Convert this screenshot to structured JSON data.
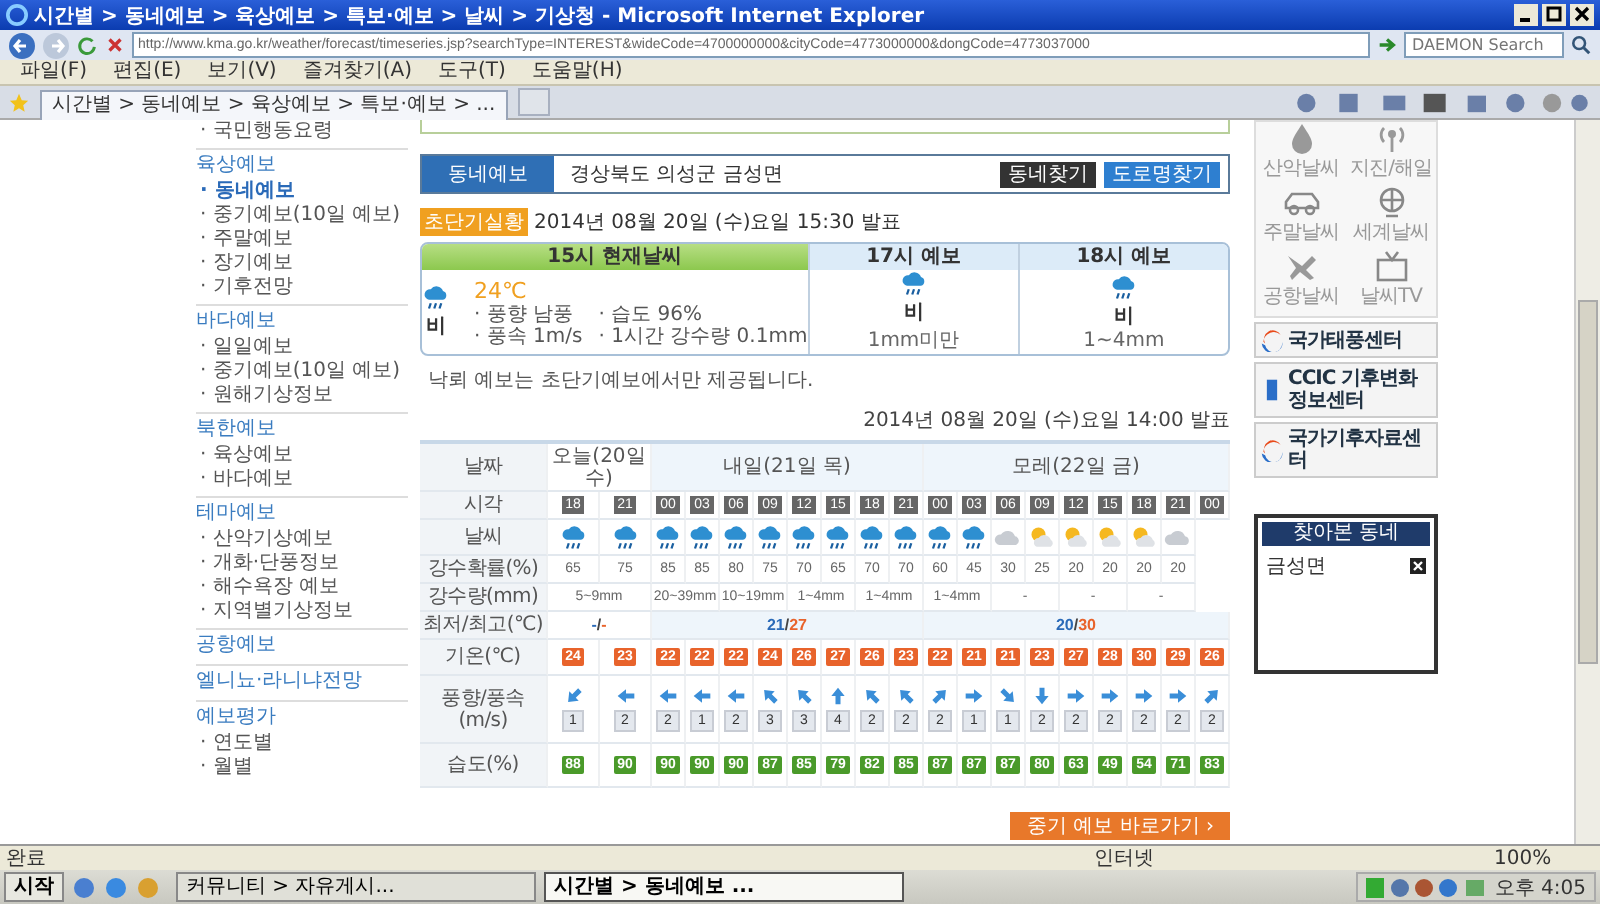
{
  "window": {
    "title": "시간별 > 동네예보 > 육상예보 > 특보·예보 > 날씨 > 기상청 - Microsoft Internet Explorer"
  },
  "address_bar": {
    "url": "http://www.kma.go.kr/weather/forecast/timeseries.jsp?searchType=INTEREST&wideCode=4700000000&cityCode=4773000000&dongCode=4773037000",
    "search_placeholder": "DAEMON Search"
  },
  "menu": [
    "파일(F)",
    "편집(E)",
    "보기(V)",
    "즐겨찾기(A)",
    "도구(T)",
    "도움말(H)"
  ],
  "tab": {
    "title": "시간별 > 동네예보 > 육상예보 > 특보·예보 > ..."
  },
  "sidebar": {
    "top_item": "· 국민행동요령",
    "sections": [
      {
        "heading": "육상예보",
        "items": [
          {
            "label": "· 동네예보",
            "selected": true
          },
          {
            "label": "· 중기예보(10일 예보)",
            "selected": false
          },
          {
            "label": "· 주말예보",
            "selected": false
          },
          {
            "label": "· 장기예보",
            "selected": false
          },
          {
            "label": "· 기후전망",
            "selected": false
          }
        ]
      },
      {
        "heading": "바다예보",
        "items": [
          {
            "label": "· 일일예보",
            "selected": false
          },
          {
            "label": "· 중기예보(10일 예보)",
            "selected": false
          },
          {
            "label": "· 원해기상정보",
            "selected": false
          }
        ]
      },
      {
        "heading": "북한예보",
        "items": [
          {
            "label": "· 육상예보",
            "selected": false
          },
          {
            "label": "· 바다예보",
            "selected": false
          }
        ]
      },
      {
        "heading": "테마예보",
        "items": [
          {
            "label": "· 산악기상예보",
            "selected": false
          },
          {
            "label": "· 개화·단풍정보",
            "selected": false
          },
          {
            "label": "· 해수욕장 예보",
            "selected": false
          },
          {
            "label": "· 지역별기상정보",
            "selected": false
          }
        ]
      },
      {
        "heading": "공항예보"
      },
      {
        "heading": "엘니뇨·라니냐전망"
      },
      {
        "heading": "예보평가",
        "items": [
          {
            "label": "· 연도별",
            "selected": false
          },
          {
            "label": "· 월별",
            "selected": false
          }
        ]
      }
    ]
  },
  "location": {
    "label": "동네예보",
    "address": "경상북도 의성군 금성면",
    "buttons": [
      "동네찾기",
      "도로명찾기"
    ]
  },
  "nowcast": {
    "badge": "초단기실황",
    "issued": "2014년 08월 20일 (수)요일 15:30 발표",
    "panels": [
      {
        "header": "15시 현재날씨",
        "selected": true,
        "weather": "비",
        "temperature": "24℃",
        "details": [
          "· 풍향 남풍",
          "· 습도 96%",
          "· 풍속 1m/s",
          "· 1시간 강수량 0.1mm"
        ]
      },
      {
        "header": "17시 예보",
        "selected": false,
        "weather": "비",
        "amount": "1mm미만"
      },
      {
        "header": "18시 예보",
        "selected": false,
        "weather": "비",
        "amount": "1~4mm"
      }
    ],
    "note": "낙뢰 예보는 초단기예보에서만 제공됩니다."
  },
  "forecast": {
    "issued": "2014년 08월 20일 (수)요일 14:00 발표",
    "labels": [
      "날짜",
      "시각",
      "날씨",
      "강수확률(%)",
      "강수량(mm)",
      "최저/최고(℃)",
      "기온(℃)",
      "풍향/풍속(m/s)",
      "습도(%)"
    ],
    "days": [
      "오늘(20일 수)",
      "내일(21일 목)",
      "모레(22일 금)"
    ],
    "times": [
      "18",
      "21",
      "00",
      "03",
      "06",
      "09",
      "12",
      "15",
      "18",
      "21",
      "00",
      "03",
      "06",
      "09",
      "12",
      "15",
      "18",
      "21",
      "00"
    ],
    "weather": [
      {
        "kind": "rain"
      },
      {
        "kind": "rain"
      },
      {
        "kind": "rain"
      },
      {
        "kind": "rain"
      },
      {
        "kind": "rain"
      },
      {
        "kind": "rain"
      },
      {
        "kind": "rain"
      },
      {
        "kind": "rain"
      },
      {
        "kind": "rain"
      },
      {
        "kind": "rain"
      },
      {
        "kind": "rain"
      },
      {
        "kind": "rain"
      },
      {
        "kind": "cloudy"
      },
      {
        "kind": "partly"
      },
      {
        "kind": "partly"
      },
      {
        "kind": "partly"
      },
      {
        "kind": "partly"
      },
      {
        "kind": "cloudy"
      }
    ],
    "probability": [
      "65",
      "75",
      "85",
      "85",
      "80",
      "75",
      "70",
      "65",
      "70",
      "70",
      "60",
      "45",
      "30",
      "25",
      "20",
      "20",
      "20",
      "20"
    ],
    "amounts": [
      "5~9mm",
      "20~39mm",
      "10~19mm",
      "1~4mm",
      "1~4mm",
      "1~4mm",
      "-",
      "-",
      "-"
    ],
    "minmax": [
      {
        "min": "-",
        "sep": "/",
        "max": "-"
      },
      {
        "min": "21",
        "sep": "/",
        "max": "27"
      },
      {
        "min": "20",
        "sep": "/",
        "max": "30"
      }
    ],
    "temperature": [
      "24",
      "23",
      "22",
      "22",
      "22",
      "24",
      "26",
      "27",
      "26",
      "23",
      "22",
      "21",
      "21",
      "23",
      "27",
      "28",
      "30",
      "29",
      "26"
    ],
    "wind": [
      {
        "kind": "down-left",
        "speed": "1"
      },
      {
        "kind": "left",
        "speed": "2"
      },
      {
        "kind": "left",
        "speed": "2"
      },
      {
        "kind": "left",
        "speed": "1"
      },
      {
        "kind": "left",
        "speed": "2"
      },
      {
        "kind": "up-left",
        "speed": "3"
      },
      {
        "kind": "up-left",
        "speed": "3"
      },
      {
        "kind": "up",
        "speed": "4"
      },
      {
        "kind": "up-left",
        "speed": "2"
      },
      {
        "kind": "up-left",
        "speed": "2"
      },
      {
        "kind": "up-right",
        "speed": "2"
      },
      {
        "kind": "right",
        "speed": "1"
      },
      {
        "kind": "down-right",
        "speed": "1"
      },
      {
        "kind": "down",
        "speed": "2"
      },
      {
        "kind": "right",
        "speed": "2"
      },
      {
        "kind": "right",
        "speed": "2"
      },
      {
        "kind": "right",
        "speed": "2"
      },
      {
        "kind": "right",
        "speed": "2"
      },
      {
        "kind": "up-right",
        "speed": "2"
      }
    ],
    "humidity": [
      "88",
      "90",
      "90",
      "90",
      "90",
      "87",
      "85",
      "79",
      "82",
      "85",
      "87",
      "87",
      "87",
      "80",
      "63",
      "49",
      "54",
      "71",
      "83"
    ],
    "more_button": "중기 예보 바로가기 ›"
  },
  "quick_links": [
    {
      "label": "산악날씨",
      "kind": "mountain"
    },
    {
      "label": "지진/해일",
      "kind": "antenna"
    },
    {
      "label": "주말날씨",
      "kind": "car"
    },
    {
      "label": "세계날씨",
      "kind": "globe"
    },
    {
      "label": "공항날씨",
      "kind": "plane"
    },
    {
      "label": "날씨TV",
      "kind": "tv"
    }
  ],
  "banners": [
    {
      "label": "국가태풍센터",
      "kind": "swirl"
    },
    {
      "label": "CCIC 기후변화정보센터",
      "kind": "ccic"
    },
    {
      "label": "국가기후자료센터",
      "kind": "swirl"
    }
  ],
  "visited": {
    "title": "찾아본 동네",
    "items": [
      "금성면"
    ]
  },
  "status_bar": {
    "text": "완료",
    "zone": "인터넷",
    "zoom": "100%"
  },
  "taskbar": {
    "start": "시작",
    "tasks": [
      {
        "label": "커뮤니티 > 자유게시...",
        "selected": false
      },
      {
        "label": "시간별 > 동네예보 ...",
        "selected": true
      }
    ],
    "clock": "오후 4:05"
  }
}
